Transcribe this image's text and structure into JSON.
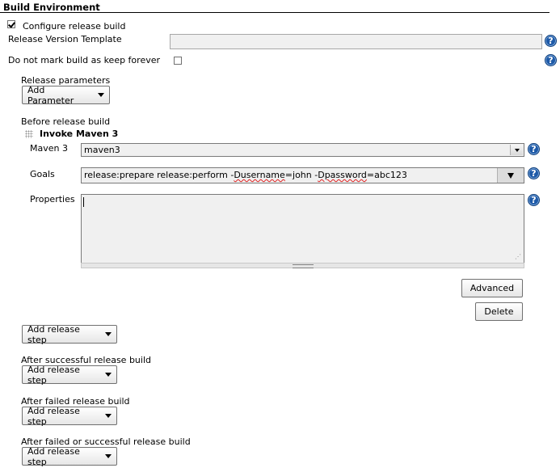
{
  "section": {
    "title": "Build Environment"
  },
  "configure_release": {
    "label": "Configure release build",
    "checked": true
  },
  "release_version_template": {
    "label": "Release Version Template",
    "value": ""
  },
  "keep_forever": {
    "label": "Do not mark build as keep forever",
    "checked": false
  },
  "release_parameters": {
    "label": "Release parameters",
    "add_button": "Add Parameter"
  },
  "before_release": {
    "label": "Before release build",
    "step": {
      "title": "Invoke Maven 3",
      "maven_label": "Maven 3",
      "maven_value": "maven3",
      "goals_label": "Goals",
      "goals_parts": {
        "p1": "release:prepare release:perform -",
        "p2": "Dusername",
        "p3": "=john -",
        "p4": "Dpassword",
        "p5": "=abc123"
      },
      "properties_label": "Properties",
      "properties_value": "",
      "advanced_button": "Advanced",
      "delete_button": "Delete"
    },
    "add_step_button": "Add release step"
  },
  "after_success": {
    "label": "After successful release build",
    "add_step_button": "Add release step"
  },
  "after_failed": {
    "label": "After failed release build",
    "add_step_button": "Add release step"
  },
  "after_any": {
    "label": "After failed or successful release build",
    "add_step_button": "Add release step"
  },
  "icons": {
    "help": "?"
  }
}
